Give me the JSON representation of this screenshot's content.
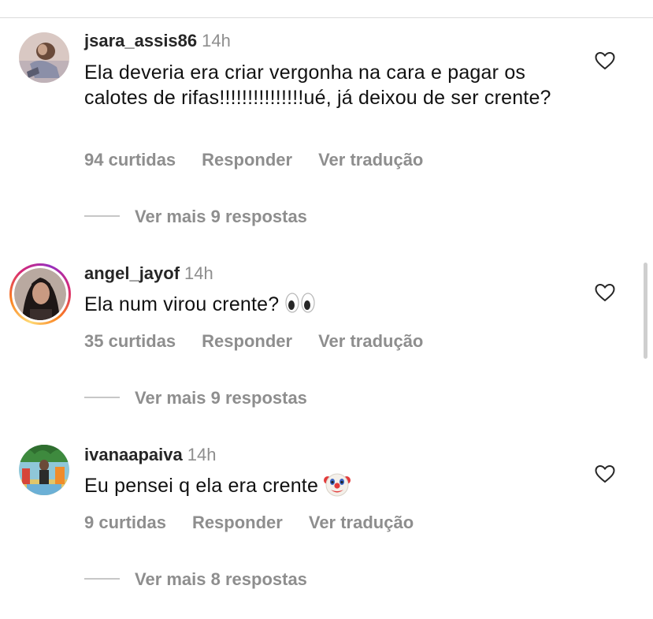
{
  "comments": [
    {
      "username": "jsara_assis86",
      "time": "14h",
      "text": "Ela deveria era criar vergonha na cara e pagar os calotes de rifas!!!!!!!!!!!!!!!ué, já deixou de ser crente?",
      "likes": "94 curtidas",
      "reply_label": "Responder",
      "translate_label": "Ver tradução",
      "more_replies": "Ver mais 9 respostas",
      "avatar_icon": "avatar-photo",
      "like_icon": "heart-outline-icon"
    },
    {
      "username": "angel_jayof",
      "time": "14h",
      "text": "Ela num virou crente?",
      "emoji": "eyes-emoji",
      "likes": "35 curtidas",
      "reply_label": "Responder",
      "translate_label": "Ver tradução",
      "more_replies": "Ver mais 9 respostas",
      "avatar_icon": "avatar-photo-story-ring",
      "like_icon": "heart-outline-icon"
    },
    {
      "username": "ivanaapaiva",
      "time": "14h",
      "text": "Eu pensei q ela era crente",
      "emoji": "clown-face-emoji",
      "likes": "9 curtidas",
      "reply_label": "Responder",
      "translate_label": "Ver tradução",
      "more_replies": "Ver mais 8 respostas",
      "avatar_icon": "avatar-photo",
      "like_icon": "heart-outline-icon"
    }
  ],
  "colors": {
    "username": "#262626",
    "secondary": "#8e8e8e",
    "divider": "#dbdbdb"
  }
}
